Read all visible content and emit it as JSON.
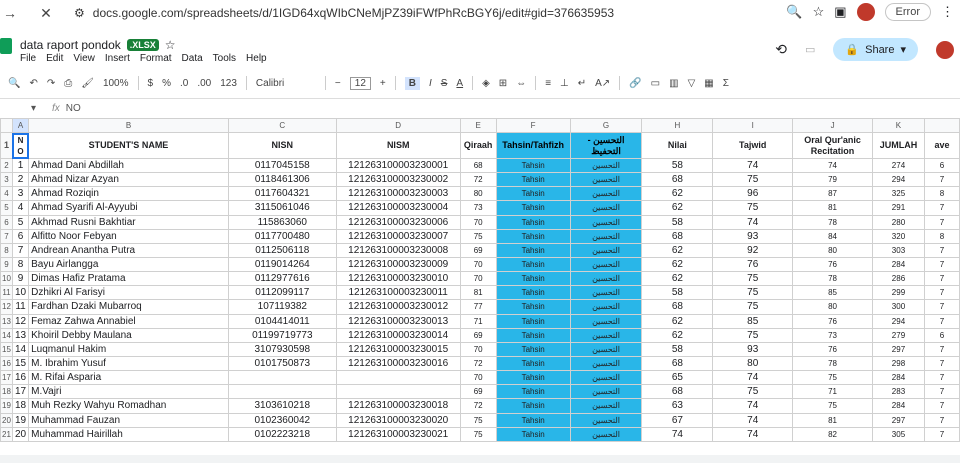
{
  "browser": {
    "url": "docs.google.com/spreadsheets/d/1IGD64xqWIbCNeMjPZ39iFWfPhRcBGY6j/edit#gid=376635953",
    "error_label": "Error"
  },
  "doc": {
    "title": "data raport pondok",
    "badge": ".XLSX",
    "menu": [
      "File",
      "Edit",
      "View",
      "Insert",
      "Format",
      "Data",
      "Tools",
      "Help"
    ],
    "share_label": "Share"
  },
  "toolbar": {
    "zoom": "100%",
    "currency": "$",
    "percent": "%",
    "dec_dec": ".0",
    "dec_inc": ".00",
    "num_fmt": "123",
    "font": "Calibri",
    "font_size": "12"
  },
  "formula": {
    "cell_ref": "",
    "content": "NO"
  },
  "columns": [
    "A",
    "B",
    "C",
    "D",
    "E",
    "F",
    "G",
    "H",
    "I",
    "J",
    "K",
    ""
  ],
  "headers": {
    "no": "N O",
    "name": "STUDENT'S NAME",
    "nisn": "NISN",
    "nism": "NISM",
    "qiraah": "Qiraah",
    "tahsin": "Tahsin/Tahfizh",
    "arabic": "- التحسين التحفيظ",
    "nilai": "Nilai",
    "tajwid": "Tajwid",
    "oral": "Oral Qur'anic Recitation",
    "jumlah": "JUMLAH",
    "ave": "ave"
  },
  "rows": [
    {
      "rn": "2",
      "no": "1",
      "name": "Ahmad Dani Abdillah",
      "nisn": "0117045158",
      "nism": "121263100003230001",
      "q": "68",
      "t": "Tahsin",
      "a": "التحسين",
      "nilai": "58",
      "taj": "74",
      "oral": "74",
      "jml": "274",
      "ave": "6"
    },
    {
      "rn": "3",
      "no": "2",
      "name": "Ahmad Nizar Azyan",
      "nisn": "0118461306",
      "nism": "121263100003230002",
      "q": "72",
      "t": "Tahsin",
      "a": "التحسين",
      "nilai": "68",
      "taj": "75",
      "oral": "79",
      "jml": "294",
      "ave": "7"
    },
    {
      "rn": "4",
      "no": "3",
      "name": "Ahmad Roziqin",
      "nisn": "0117604321",
      "nism": "121263100003230003",
      "q": "80",
      "t": "Tahsin",
      "a": "التحسين",
      "nilai": "62",
      "taj": "96",
      "oral": "87",
      "jml": "325",
      "ave": "8"
    },
    {
      "rn": "5",
      "no": "4",
      "name": "Ahmad Syarifi Al-Ayyubi",
      "nisn": "3115061046",
      "nism": "121263100003230004",
      "q": "73",
      "t": "Tahsin",
      "a": "التحسين",
      "nilai": "62",
      "taj": "75",
      "oral": "81",
      "jml": "291",
      "ave": "7"
    },
    {
      "rn": "6",
      "no": "5",
      "name": "Akhmad Rusni Bakhtiar",
      "nisn": "115863060",
      "nism": "121263100003230006",
      "q": "70",
      "t": "Tahsin",
      "a": "التحسين",
      "nilai": "58",
      "taj": "74",
      "oral": "78",
      "jml": "280",
      "ave": "7"
    },
    {
      "rn": "7",
      "no": "6",
      "name": "Alfitto Noor Febyan",
      "nisn": "0117700480",
      "nism": "121263100003230007",
      "q": "75",
      "t": "Tahsin",
      "a": "التحسين",
      "nilai": "68",
      "taj": "93",
      "oral": "84",
      "jml": "320",
      "ave": "8"
    },
    {
      "rn": "8",
      "no": "7",
      "name": "Andrean Anantha Putra",
      "nisn": "0112506118",
      "nism": "121263100003230008",
      "q": "69",
      "t": "Tahsin",
      "a": "التحسين",
      "nilai": "62",
      "taj": "92",
      "oral": "80",
      "jml": "303",
      "ave": "7"
    },
    {
      "rn": "9",
      "no": "8",
      "name": "Bayu Airlangga",
      "nisn": "0119014264",
      "nism": "121263100003230009",
      "q": "70",
      "t": "Tahsin",
      "a": "التحسين",
      "nilai": "62",
      "taj": "76",
      "oral": "76",
      "jml": "284",
      "ave": "7"
    },
    {
      "rn": "10",
      "no": "9",
      "name": "Dimas Hafiz Pratama",
      "nisn": "0112977616",
      "nism": "121263100003230010",
      "q": "70",
      "t": "Tahsin",
      "a": "التحسين",
      "nilai": "62",
      "taj": "75",
      "oral": "78",
      "jml": "286",
      "ave": "7"
    },
    {
      "rn": "11",
      "no": "10",
      "name": "Dzhikri Al Farisyi",
      "nisn": "0112099117",
      "nism": "121263100003230011",
      "q": "81",
      "t": "Tahsin",
      "a": "التحسين",
      "nilai": "58",
      "taj": "75",
      "oral": "85",
      "jml": "299",
      "ave": "7"
    },
    {
      "rn": "12",
      "no": "11",
      "name": "Fardhan Dzaki Mubarroq",
      "nisn": "107119382",
      "nism": "121263100003230012",
      "q": "77",
      "t": "Tahsin",
      "a": "التحسين",
      "nilai": "68",
      "taj": "75",
      "oral": "80",
      "jml": "300",
      "ave": "7"
    },
    {
      "rn": "13",
      "no": "12",
      "name": "Femaz Zahwa Annabiel",
      "nisn": "0104414011",
      "nism": "121263100003230013",
      "q": "71",
      "t": "Tahsin",
      "a": "التحسين",
      "nilai": "62",
      "taj": "85",
      "oral": "76",
      "jml": "294",
      "ave": "7"
    },
    {
      "rn": "14",
      "no": "13",
      "name": "Khoiril Debby Maulana",
      "nisn": "01199719773",
      "nism": "121263100003230014",
      "q": "69",
      "t": "Tahsin",
      "a": "التحسين",
      "nilai": "62",
      "taj": "75",
      "oral": "73",
      "jml": "279",
      "ave": "6"
    },
    {
      "rn": "15",
      "no": "14",
      "name": "Luqmanul Hakim",
      "nisn": "3107930598",
      "nism": "121263100003230015",
      "q": "70",
      "t": "Tahsin",
      "a": "التحسين",
      "nilai": "58",
      "taj": "93",
      "oral": "76",
      "jml": "297",
      "ave": "7"
    },
    {
      "rn": "16",
      "no": "15",
      "name": "M. Ibrahim Yusuf",
      "nisn": "0101750873",
      "nism": "121263100003230016",
      "q": "72",
      "t": "Tahsin",
      "a": "التحسين",
      "nilai": "68",
      "taj": "80",
      "oral": "78",
      "jml": "298",
      "ave": "7"
    },
    {
      "rn": "17",
      "no": "16",
      "name": "M. Rifai Asparia",
      "nisn": "",
      "nism": "",
      "q": "70",
      "t": "Tahsin",
      "a": "التحسين",
      "nilai": "65",
      "taj": "74",
      "oral": "75",
      "jml": "284",
      "ave": "7"
    },
    {
      "rn": "18",
      "no": "17",
      "name": "M.Vajri",
      "nisn": "",
      "nism": "",
      "q": "69",
      "t": "Tahsin",
      "a": "التحسين",
      "nilai": "68",
      "taj": "75",
      "oral": "71",
      "jml": "283",
      "ave": "7"
    },
    {
      "rn": "19",
      "no": "18",
      "name": "Muh Rezky Wahyu Romadhan",
      "nisn": "3103610218",
      "nism": "121263100003230018",
      "q": "72",
      "t": "Tahsin",
      "a": "التحسين",
      "nilai": "63",
      "taj": "74",
      "oral": "75",
      "jml": "284",
      "ave": "7"
    },
    {
      "rn": "20",
      "no": "19",
      "name": "Muhammad Fauzan",
      "nisn": "0102360042",
      "nism": "121263100003230020",
      "q": "75",
      "t": "Tahsin",
      "a": "التحسين",
      "nilai": "67",
      "taj": "74",
      "oral": "81",
      "jml": "297",
      "ave": "7"
    },
    {
      "rn": "21",
      "no": "20",
      "name": "Muhammad Hairillah",
      "nisn": "0102223218",
      "nism": "121263100003230021",
      "q": "75",
      "t": "Tahsin",
      "a": "التحسين",
      "nilai": "74",
      "taj": "74",
      "oral": "82",
      "jml": "305",
      "ave": "7"
    }
  ]
}
